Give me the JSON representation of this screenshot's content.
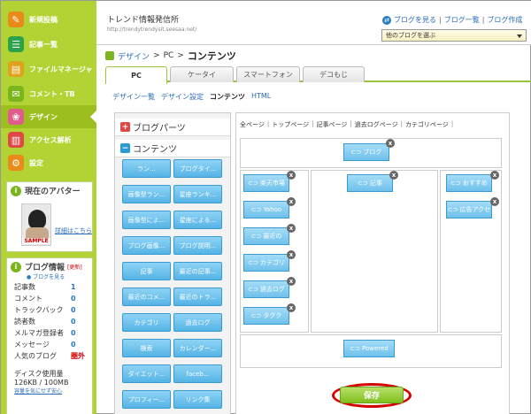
{
  "sidebar": {
    "items": [
      {
        "label": "新規投稿",
        "icon": "pencil-icon",
        "color": "#e88b1b"
      },
      {
        "label": "記事一覧",
        "icon": "document-list-icon",
        "color": "#2aa34b"
      },
      {
        "label": "ファイルマネージャ",
        "icon": "folder-icon",
        "color": "#e0a21b"
      },
      {
        "label": "コメント・TB",
        "icon": "comment-icon",
        "color": "#7ab51d"
      },
      {
        "label": "デザイン",
        "icon": "palette-icon",
        "color": "#e05c8c"
      },
      {
        "label": "アクセス解析",
        "icon": "bar-chart-icon",
        "color": "#e04848"
      },
      {
        "label": "設定",
        "icon": "gear-icon",
        "color": "#e88b1b"
      }
    ],
    "avatar_box": {
      "title": "現在のアバター",
      "avatar_label": "SAMPLE",
      "details_link": "詳細はこちら"
    },
    "blog_info": {
      "title": "ブログ情報",
      "update_link": "[更新]",
      "view_blog_link": "ブログを見る",
      "stats": [
        {
          "label": "記事数",
          "value": "1"
        },
        {
          "label": "コメント",
          "value": "0"
        },
        {
          "label": "トラックバック",
          "value": "0"
        },
        {
          "label": "読者数",
          "value": "0"
        },
        {
          "label": "メルマガ登録者",
          "value": "0"
        },
        {
          "label": "メッセージ",
          "value": "0"
        },
        {
          "label": "人気のブログ",
          "value": "圏外"
        }
      ],
      "disk_label": "ディスク使用量",
      "disk_value": "126KB / 100MB",
      "disk_note": "容量を気にせず安心"
    }
  },
  "header": {
    "blog_title": "トレンド情報発信所",
    "blog_url": "http://trendytrendysit.seesaa.net/",
    "links": [
      "ブログを見る",
      "ブログ一覧",
      "ブログ作成"
    ],
    "select_value": "他のブログを選ぶ"
  },
  "breadcrumb": {
    "design": "デザイン",
    "pc": "PC",
    "current": "コンテンツ"
  },
  "tabs": [
    "PC",
    "ケータイ",
    "スマートフォン",
    "デコもじ"
  ],
  "subnav": [
    "デザイン一覧",
    "デザイン設定",
    "コンテンツ",
    "HTML"
  ],
  "parts_panel": {
    "blog_parts_label": "ブログパーツ",
    "contents_label": "コンテンツ",
    "buttons": [
      "ラン...",
      "ブログタイ...",
      "画像型ラン...",
      "星座ランキ...",
      "画像型によ...",
      "星座による...",
      "ブログ画像...",
      "ブログ説明...",
      "記事",
      "最近の記事...",
      "最近のコメ...",
      "最近のトラ...",
      "カテゴリ",
      "過去ログ",
      "検索",
      "カレンダー...",
      "ダイエット...",
      "faceb...",
      "プロフィー...",
      "リンク集"
    ]
  },
  "layout": {
    "page_links": [
      "全ページ",
      "トップページ",
      "記事ページ",
      "過去ログページ",
      "カテゴリページ"
    ],
    "top_block": "ブログ",
    "left_column": [
      "楽天市場",
      "Yahoo",
      "最近の",
      "カテゴリ",
      "過去ログ",
      "タグク"
    ],
    "center_column": [
      "記事"
    ],
    "right_column": [
      "おすすめ",
      "広告アクセ"
    ],
    "bottom_block": "Powered",
    "save_label": "保存"
  },
  "colors": {
    "sidebar_green": "#b3d335",
    "part_blue": "#55b4e6",
    "save_green": "#7fbf1e",
    "highlight_red": "#d40000"
  }
}
